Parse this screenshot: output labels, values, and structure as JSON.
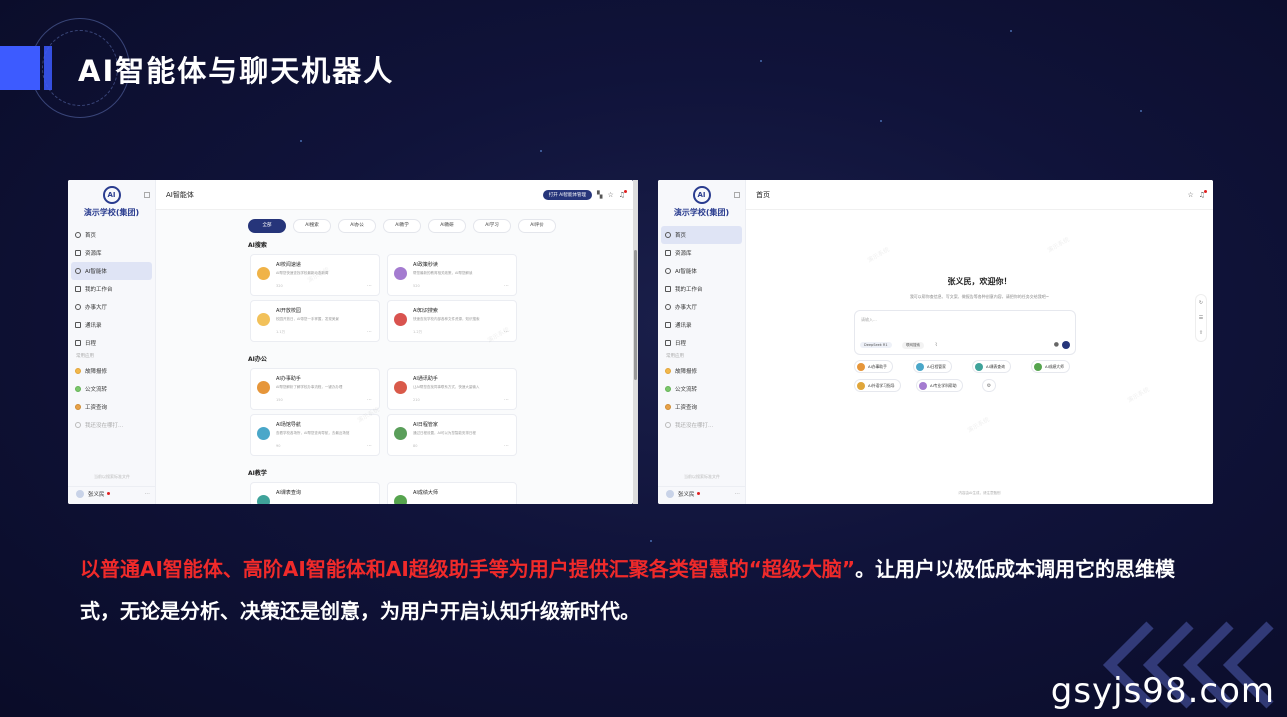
{
  "slide": {
    "title": "AI智能体与聊天机器人",
    "caption_part1": "以普通AI智能体、高阶AI智能体和AI超级助手等为用户提供汇聚各类智慧的“超级大脑”",
    "caption_part2": "。让用户以极低成本调用它的思维模式，无论是分析、决策还是创意，为用户开启认知升级新时代。",
    "site": "gsyjs98.com",
    "accent_color": "#3d5bff",
    "highlight_color": "#f02a2a"
  },
  "left": {
    "logo_text": "AI",
    "org": "演示学校(集团)",
    "page_title": "AI智能体",
    "open_button": "打开 AI智能体管理",
    "menu": [
      {
        "label": "首页",
        "icon": "home-icon"
      },
      {
        "label": "资源库",
        "icon": "file-icon"
      },
      {
        "label": "AI智能体",
        "icon": "robot-icon"
      },
      {
        "label": "我的工作台",
        "icon": "grid-icon"
      },
      {
        "label": "办事大厅",
        "icon": "clock-icon"
      },
      {
        "label": "通讯录",
        "icon": "contacts-icon"
      },
      {
        "label": "日程",
        "icon": "calendar-icon"
      }
    ],
    "group_label": "常用应用",
    "apps": [
      "故障报修",
      "公文流转",
      "工资查询"
    ],
    "add_app": "我还没在哪打...",
    "side_foot": "当前以搜索标准文件",
    "user": "张义民",
    "tabs": [
      "全部",
      "AI搜索",
      "AI办公",
      "AI教学",
      "AI教研",
      "AI学习",
      "AI评价"
    ],
    "sections": [
      {
        "title": "AI搜索",
        "cards": [
          {
            "name": "AI校闻速递",
            "desc": "AI帮您快速查找学校最新动态新闻",
            "meta": "320"
          },
          {
            "name": "AI政策秒读",
            "desc": "帮您最新的教育相关政策，AI帮您解读",
            "meta": "520"
          },
          {
            "name": "AI开放校园",
            "desc": "校园开放日，AI带您一手掌握，发现美景",
            "meta": "1.1万"
          },
          {
            "name": "AI知识搜索",
            "desc": "快速查找学校内部各种文件资源，知识搜索",
            "meta": "1.2万"
          }
        ]
      },
      {
        "title": "AI办公",
        "cards": [
          {
            "name": "AI办事助手",
            "desc": "AI帮您解析了解学校办事流程，一键办办理",
            "meta": "150"
          },
          {
            "name": "AI通讯助手",
            "desc": "让AI帮您查找同事联系方式，快速大量输入",
            "meta": "210"
          },
          {
            "name": "AI场馆导航",
            "desc": "查看学校各场所，AI帮您查询导航，去最近场馆",
            "meta": "90"
          },
          {
            "name": "AI日程管家",
            "desc": "通过日程设置，AI可以为您智能安排日程",
            "meta": "80"
          }
        ]
      },
      {
        "title": "AI教学",
        "cards": [
          {
            "name": "AI课表查询",
            "desc": "",
            "meta": ""
          },
          {
            "name": "AI成绩大师",
            "desc": "",
            "meta": ""
          }
        ]
      }
    ],
    "watermark": "演示系统"
  },
  "right": {
    "logo_text": "AI",
    "org": "演示学校(集团)",
    "page_title": "首页",
    "greeting": "张义民，欢迎你！",
    "greeting_sub": "我可以帮你查信息、写文案、做报告等各种创意内容，请把你的任务交给我吧~",
    "input_placeholder": "请输入...",
    "model": "DeepSeek R1",
    "net_search": "联网搜索",
    "chips": [
      "AI办事助手",
      "AI日程管家",
      "AI课表查询",
      "AI成绩大师",
      "AI外语学习指导",
      "AI专业学科帮助"
    ],
    "bottom_tip": "内容由AI生成，请注意甄别",
    "menu_active": "首页"
  }
}
